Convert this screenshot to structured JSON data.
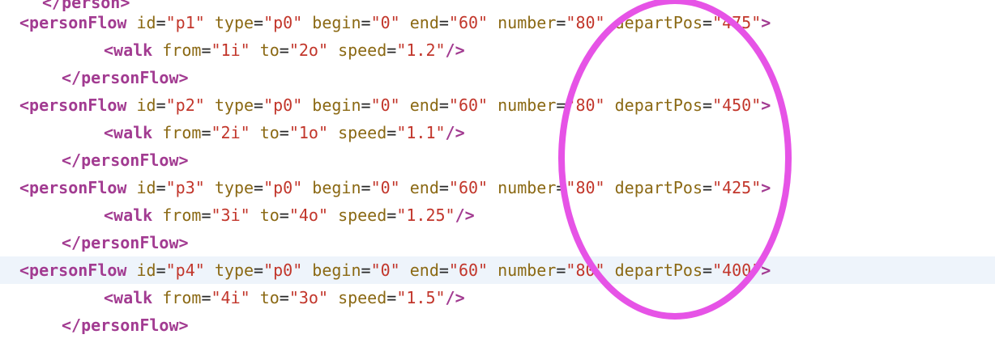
{
  "editor": {
    "partial_top_line": "</person>",
    "lines": [
      {
        "indent": 0,
        "kind": "open",
        "tag": "<personFlow",
        "attrs": [
          {
            "name": "id",
            "value": "\"p1\""
          },
          {
            "name": "type",
            "value": "\"p0\""
          },
          {
            "name": "begin",
            "value": "\"0\""
          },
          {
            "name": "end",
            "value": "\"60\""
          },
          {
            "name": "number",
            "value": "\"80\""
          },
          {
            "name": "departPos",
            "value": "\"475\""
          }
        ],
        "close": ">"
      },
      {
        "indent": 1,
        "kind": "selfclose",
        "tag": "<walk",
        "attrs": [
          {
            "name": "from",
            "value": "\"1i\""
          },
          {
            "name": "to",
            "value": "\"2o\""
          },
          {
            "name": "speed",
            "value": "\"1.2\""
          }
        ],
        "close": "/>"
      },
      {
        "indent": 0.5,
        "kind": "end",
        "tag": "</personFlow>",
        "attrs": [],
        "close": ""
      },
      {
        "indent": 0,
        "kind": "open",
        "tag": "<personFlow",
        "attrs": [
          {
            "name": "id",
            "value": "\"p2\""
          },
          {
            "name": "type",
            "value": "\"p0\""
          },
          {
            "name": "begin",
            "value": "\"0\""
          },
          {
            "name": "end",
            "value": "\"60\""
          },
          {
            "name": "number",
            "value": "\"80\""
          },
          {
            "name": "departPos",
            "value": "\"450\""
          }
        ],
        "close": ">"
      },
      {
        "indent": 1,
        "kind": "selfclose",
        "tag": "<walk",
        "attrs": [
          {
            "name": "from",
            "value": "\"2i\""
          },
          {
            "name": "to",
            "value": "\"1o\""
          },
          {
            "name": "speed",
            "value": "\"1.1\""
          }
        ],
        "close": "/>"
      },
      {
        "indent": 0.5,
        "kind": "end",
        "tag": "</personFlow>",
        "attrs": [],
        "close": ""
      },
      {
        "indent": 0,
        "kind": "open",
        "tag": "<personFlow",
        "attrs": [
          {
            "name": "id",
            "value": "\"p3\""
          },
          {
            "name": "type",
            "value": "\"p0\""
          },
          {
            "name": "begin",
            "value": "\"0\""
          },
          {
            "name": "end",
            "value": "\"60\""
          },
          {
            "name": "number",
            "value": "\"80\""
          },
          {
            "name": "departPos",
            "value": "\"425\""
          }
        ],
        "close": ">"
      },
      {
        "indent": 1,
        "kind": "selfclose",
        "tag": "<walk",
        "attrs": [
          {
            "name": "from",
            "value": "\"3i\""
          },
          {
            "name": "to",
            "value": "\"4o\""
          },
          {
            "name": "speed",
            "value": "\"1.25\""
          }
        ],
        "close": "/>"
      },
      {
        "indent": 0.5,
        "kind": "end",
        "tag": "</personFlow>",
        "attrs": [],
        "close": ""
      },
      {
        "indent": 0,
        "kind": "open",
        "highlight": true,
        "tag": "<personFlow",
        "attrs": [
          {
            "name": "id",
            "value": "\"p4\""
          },
          {
            "name": "type",
            "value": "\"p0\""
          },
          {
            "name": "begin",
            "value": "\"0\""
          },
          {
            "name": "end",
            "value": "\"60\""
          },
          {
            "name": "number",
            "value": "\"80\""
          },
          {
            "name": "departPos",
            "value": "\"400\""
          }
        ],
        "close": ">"
      },
      {
        "indent": 1,
        "kind": "selfclose",
        "tag": "<walk",
        "attrs": [
          {
            "name": "from",
            "value": "\"4i\""
          },
          {
            "name": "to",
            "value": "\"3o\""
          },
          {
            "name": "speed",
            "value": "\"1.5\""
          }
        ],
        "close": "/>"
      },
      {
        "indent": 0.5,
        "kind": "end",
        "tag": "</personFlow>",
        "attrs": [],
        "close": ""
      }
    ]
  },
  "annotation": {
    "shape": "ellipse",
    "color": "#e653e6"
  },
  "colors": {
    "tag": "#a23b91",
    "attribute": "#8b6914",
    "value": "#c2362b",
    "highlight_line": "#eef4fb"
  }
}
